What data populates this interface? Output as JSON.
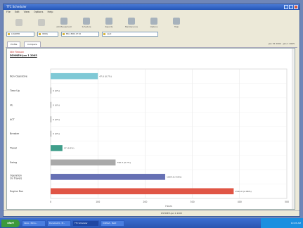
{
  "window": {
    "title": "TTC Scheduler"
  },
  "menu": [
    "File",
    "Edit",
    "View",
    "Options",
    "Help"
  ],
  "toolbar": [
    {
      "label": "",
      "disabled": true
    },
    {
      "label": "",
      "disabled": true
    },
    {
      "label": "Add Equipment"
    },
    {
      "label": "Schedule"
    },
    {
      "label": "Reports"
    },
    {
      "label": "Maintenance"
    },
    {
      "label": "Options"
    },
    {
      "label": "Help"
    }
  ],
  "combos": [
    "LOADER",
    "980G",
    "BK-1806-1710",
    "Last"
  ],
  "tabs": [
    "Profile",
    "Compare"
  ],
  "date_range": "Jan 15 2004 - Jan 1 2005",
  "report": {
    "title": "Idle Reason",
    "subtitle": "D5HNEH-Jan 1 2005"
  },
  "chart_data": {
    "type": "bar",
    "orientation": "horizontal",
    "categories": [
      "Non-Operative",
      "Time Up",
      "HL",
      "ACT",
      "Breaker",
      "Travel",
      "Swing",
      "Operation (% Travel)",
      "Engine Run"
    ],
    "values": [
      4,
      0,
      0,
      0,
      0,
      1,
      5.5,
      9.7,
      15.5
    ],
    "data_labels": [
      "47.6 (0.7%)",
      "0 (0%)",
      "0 (0%)",
      "0 (0%)",
      "0 (0%)",
      "37 (0.2%)",
      "790.3 (0.7%)",
      "1004.3 (4.8%)",
      "1544.0 (2.98%)"
    ],
    "colors": [
      "#7fc9d6",
      "#888888",
      "#888888",
      "#888888",
      "#888888",
      "#3f9e8a",
      "#a9a9a9",
      "#6670b4",
      "#e05545"
    ],
    "xlim": [
      0,
      20
    ],
    "xticks": [
      "0",
      "100",
      "200",
      "300",
      "400",
      "500"
    ],
    "xlabel": "Hours",
    "grid": true
  },
  "status": {
    "middle": "D5HNEH-Jan 1 2005"
  },
  "taskbar": {
    "start_label": "start",
    "tasks": [
      "Inbox - Micro...",
      "Document1 - M...",
      "TTC Scheduler",
      "Untitled - Paint"
    ],
    "clock": "10:45 AM"
  }
}
